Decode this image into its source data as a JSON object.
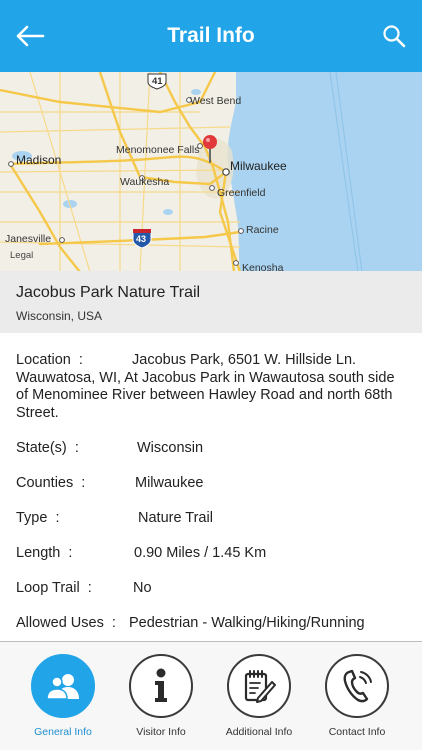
{
  "header": {
    "title": "Trail Info",
    "back_icon": "back-arrow-icon",
    "search_icon": "search-icon"
  },
  "map": {
    "labels": {
      "highway_41": "41",
      "west_bend": "West Bend",
      "menomonee_falls": "Menomonee Falls",
      "madison": "Madison",
      "milwaukee": "Milwaukee",
      "waukesha": "Waukesha",
      "greenfield": "Greenfield",
      "janesville": "Janesville",
      "interstate_43": "43",
      "racine": "Racine",
      "kenosha": "Kenosha",
      "legal": "Legal"
    },
    "colors": {
      "water": "#a9d3f0",
      "land": "#f2efe6",
      "roads": "#f5c84a",
      "pin": "#e0383b"
    }
  },
  "trail": {
    "name": "Jacobus Park Nature Trail",
    "region": "Wisconsin, USA"
  },
  "details": {
    "location_label": "Location  :",
    "location_value": "Jacobus Park, 6501 W. Hillside Ln. Wauwatosa, WI, At Jacobus Park in Wawautosa south side of Menominee River between Hawley Road and north 68th Street.",
    "state_label": "State(s)  :",
    "state_value": "Wisconsin",
    "counties_label": "Counties  :",
    "counties_value": "Milwaukee",
    "type_label": "Type  :",
    "type_value": "Nature Trail",
    "length_label": "Length  :",
    "length_value": "0.90 Miles / 1.45 Km",
    "loop_label": "Loop Trail  :",
    "loop_value": "No",
    "uses_label": "Allowed Uses  :",
    "uses_value": "Pedestrian - Walking/Hiking/Running"
  },
  "tabs": [
    {
      "label": "General Info",
      "icon": "people-icon",
      "active": true
    },
    {
      "label": "Visitor Info",
      "icon": "info-icon",
      "active": false
    },
    {
      "label": "Additional Info",
      "icon": "edit-note-icon",
      "active": false
    },
    {
      "label": "Contact Info",
      "icon": "phone-icon",
      "active": false
    }
  ],
  "colors": {
    "accent": "#21a4e8",
    "title_block_bg": "#ebebeb"
  }
}
